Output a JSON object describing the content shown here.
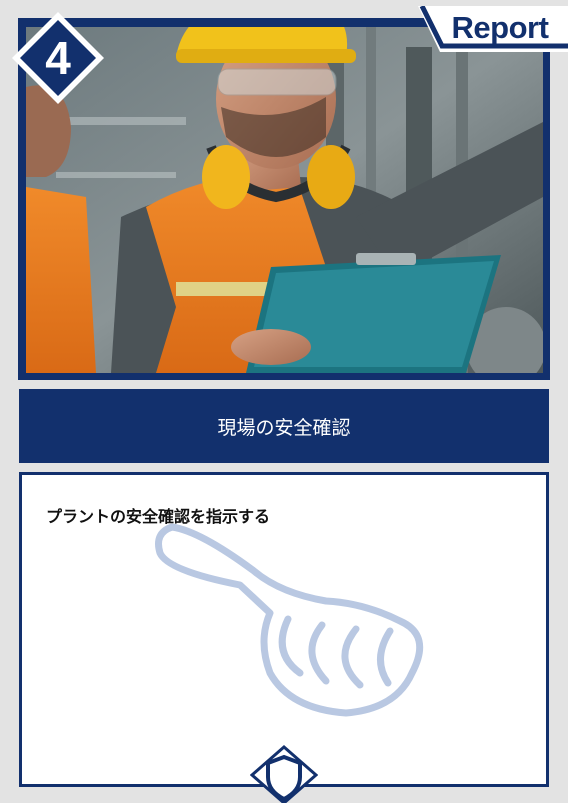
{
  "card": {
    "number": "4",
    "tag": "Report",
    "title": "現場の安全確認",
    "description": "プラントの安全確認を指示する"
  },
  "colors": {
    "navy": "#12306d",
    "background": "#e3e3e3",
    "hand_outline": "#b9c8e2"
  },
  "icons": {
    "illustration": "pointing-hand-icon",
    "emblem": "shield-icon"
  }
}
